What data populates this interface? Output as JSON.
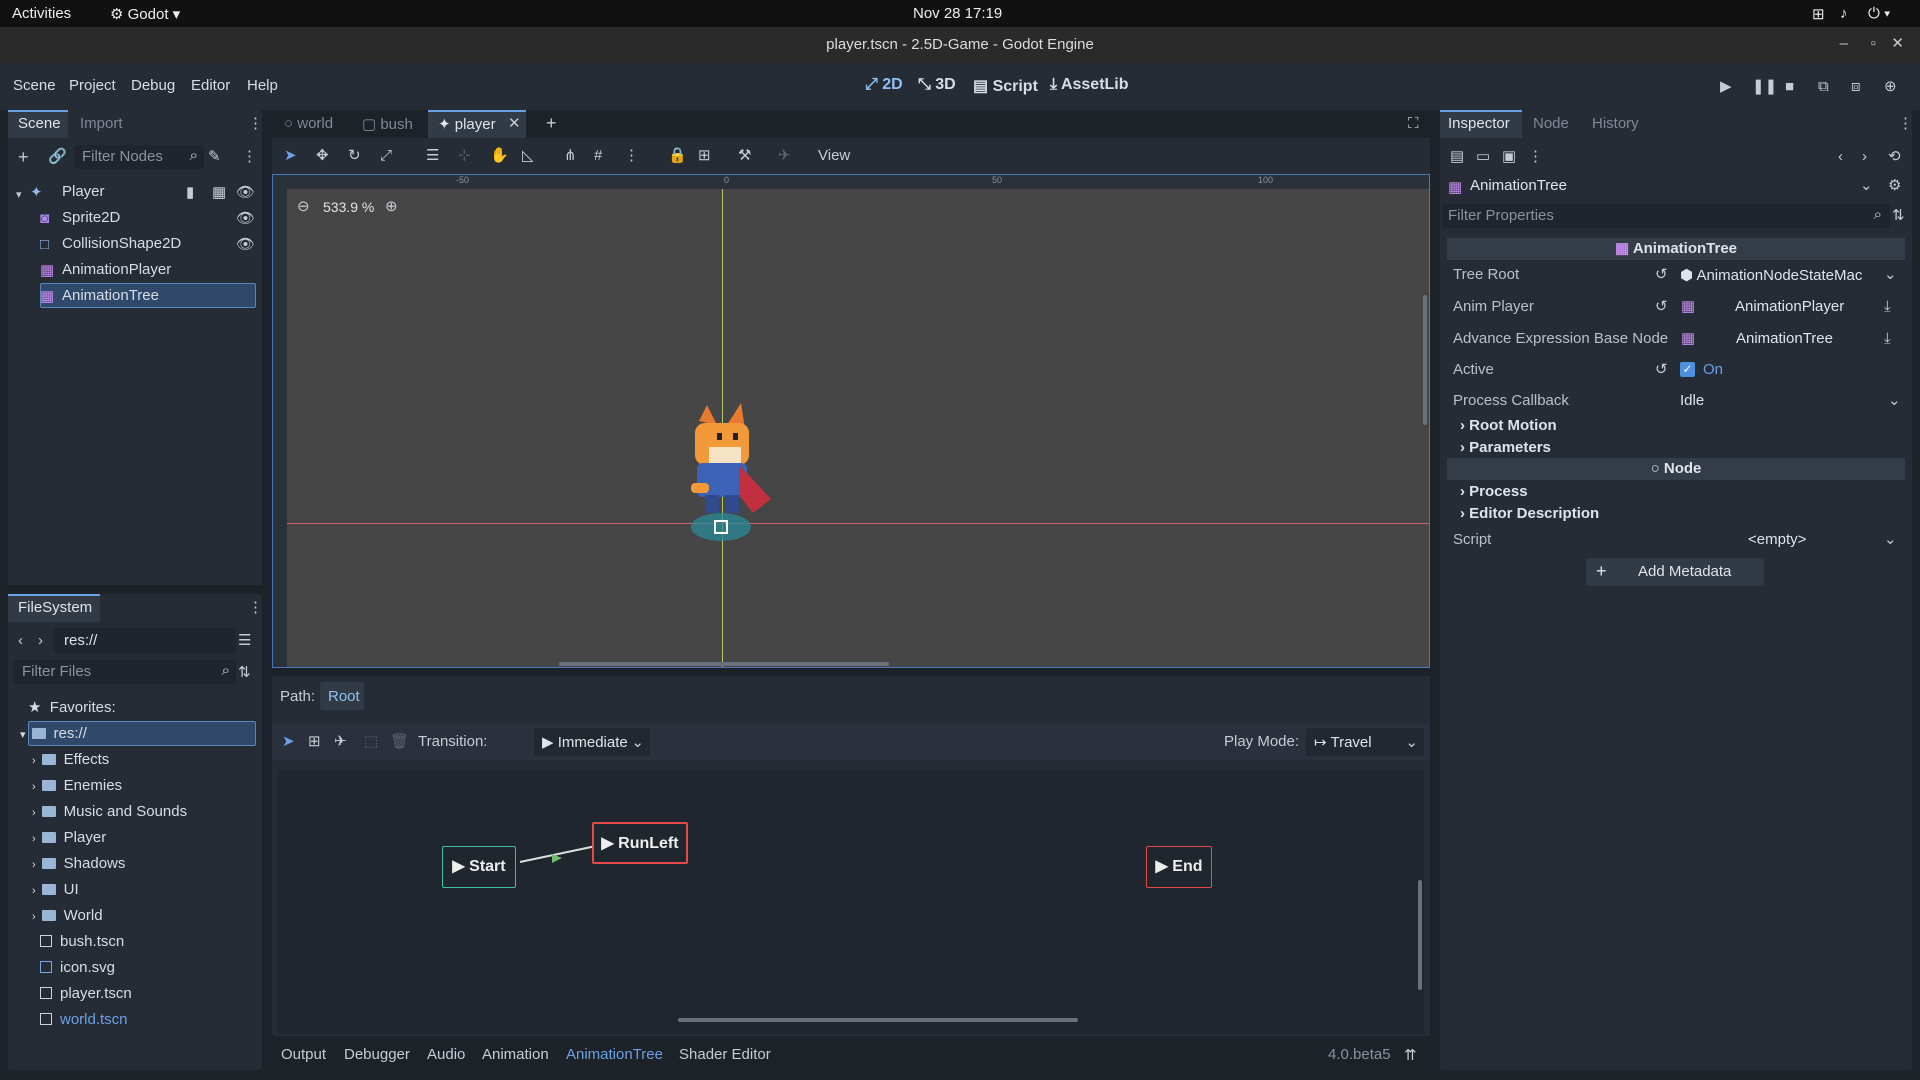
{
  "system_bar": {
    "activities": "Activities",
    "app": "Godot",
    "clock": "Nov 28  17:19"
  },
  "window": {
    "title": "player.tscn - 2.5D-Game - Godot Engine"
  },
  "menu": [
    "Scene",
    "Project",
    "Debug",
    "Editor",
    "Help"
  ],
  "workspaces": [
    "2D",
    "3D",
    "Script",
    "AssetLib"
  ],
  "scene_dock": {
    "tabs": [
      "Scene",
      "Import"
    ],
    "filter_placeholder": "Filter Nodes",
    "nodes": [
      {
        "label": "Player",
        "icon": "player-node-icon"
      },
      {
        "label": "Sprite2D",
        "icon": "sprite2d-icon"
      },
      {
        "label": "CollisionShape2D",
        "icon": "collision-shape-icon"
      },
      {
        "label": "AnimationPlayer",
        "icon": "animation-player-icon"
      },
      {
        "label": "AnimationTree",
        "icon": "animation-tree-icon"
      }
    ]
  },
  "filesystem": {
    "title": "FileSystem",
    "path": "res://",
    "filter_placeholder": "Filter Files",
    "favorites": "Favorites:",
    "root": "res://",
    "folders": [
      "Effects",
      "Enemies",
      "Music and Sounds",
      "Player",
      "Shadows",
      "UI",
      "World"
    ],
    "files": [
      "bush.tscn",
      "icon.svg",
      "player.tscn",
      "world.tscn"
    ]
  },
  "editor_tabs": [
    "world",
    "bush",
    "player"
  ],
  "viewport": {
    "zoom": "533.9 %",
    "view_menu": "View",
    "ruler": [
      "-50",
      "0",
      "50",
      "100"
    ]
  },
  "state_machine": {
    "path_label": "Path:",
    "path_value": "Root",
    "transition_label": "Transition:",
    "transition_value": "Immediate",
    "play_mode_label": "Play Mode:",
    "play_mode_value": "Travel",
    "nodes": [
      "Start",
      "RunLeft",
      "End"
    ]
  },
  "bottom_tabs": [
    "Output",
    "Debugger",
    "Audio",
    "Animation",
    "AnimationTree",
    "Shader Editor"
  ],
  "version": "4.0.beta5",
  "inspector": {
    "tabs": [
      "Inspector",
      "Node",
      "History"
    ],
    "object": "AnimationTree",
    "filter_placeholder": "Filter Properties",
    "class_header": "AnimationTree",
    "props": {
      "tree_root_label": "Tree Root",
      "tree_root_value": "AnimationNodeStateMac",
      "anim_player_label": "Anim Player",
      "anim_player_value": "AnimationPlayer",
      "adv_label": "Advance Expression Base Node",
      "adv_value": "AnimationTree",
      "active_label": "Active",
      "active_value": "On",
      "callback_label": "Process Callback",
      "callback_value": "Idle"
    },
    "sections": [
      "Root Motion",
      "Parameters"
    ],
    "node_header": "Node",
    "node_sections": [
      "Process",
      "Editor Description"
    ],
    "script_label": "Script",
    "script_value": "<empty>",
    "add_metadata": "Add Metadata"
  },
  "colors": {
    "accent": "#69a1e3",
    "selection": "#30496b",
    "panel": "#262c36",
    "start_border": "#3fc0a0",
    "node_border": "#e44a4a"
  }
}
